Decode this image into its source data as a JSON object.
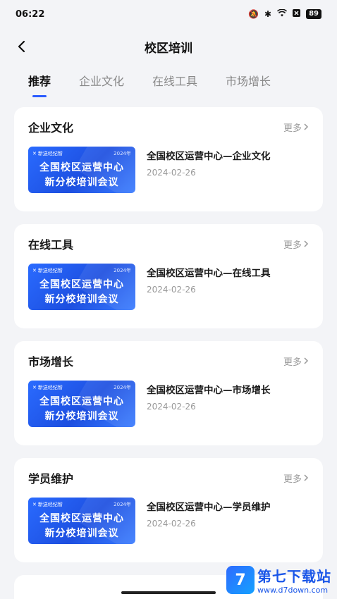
{
  "status": {
    "time": "06:22",
    "battery": "89"
  },
  "nav": {
    "title": "校区培训"
  },
  "tabs": [
    "推荐",
    "企业文化",
    "在线工具",
    "市场增长"
  ],
  "more_label": "更多",
  "thumb": {
    "brand": "新送经纪智",
    "year": "2024年",
    "line1": "全国校区运营中心",
    "line2": "新分校培训会议"
  },
  "sections": [
    {
      "title": "企业文化",
      "item_title": "全国校区运营中心—企业文化",
      "item_date": "2024-02-26"
    },
    {
      "title": "在线工具",
      "item_title": "全国校区运营中心—在线工具",
      "item_date": "2024-02-26"
    },
    {
      "title": "市场增长",
      "item_title": "全国校区运营中心—市场增长",
      "item_date": "2024-02-26"
    },
    {
      "title": "学员维护",
      "item_title": "全国校区运营中心—学员维护",
      "item_date": "2024-02-26"
    }
  ],
  "watermark": {
    "logo": "7",
    "name": "第七下载站",
    "url": "www.d7down.com"
  },
  "colors": {
    "accent": "#2b5bff",
    "background": "#f3f4f7",
    "card": "#ffffff"
  }
}
